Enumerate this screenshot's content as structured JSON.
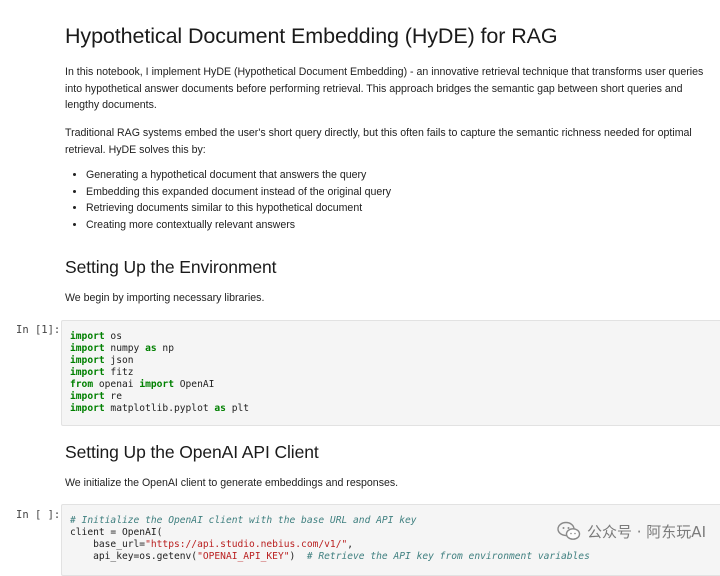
{
  "title": "Hypothetical Document Embedding (HyDE) for RAG",
  "intro_paragraph_1": "In this notebook, I implement HyDE (Hypothetical Document Embedding) - an innovative retrieval technique that transforms user queries into hypothetical answer documents before performing retrieval. This approach bridges the semantic gap between short queries and lengthy documents.",
  "intro_paragraph_2": "Traditional RAG systems embed the user's short query directly, but this often fails to capture the semantic richness needed for optimal retrieval. HyDE solves this by:",
  "hyde_steps": [
    "Generating a hypothetical document that answers the query",
    "Embedding this expanded document instead of the original query",
    "Retrieving documents similar to this hypothetical document",
    "Creating more contextually relevant answers"
  ],
  "section_1": {
    "heading": "Setting Up the Environment",
    "text": "We begin by importing necessary libraries."
  },
  "cell_1": {
    "prompt": "In [1]:",
    "code_lines": [
      [
        {
          "t": "import",
          "c": "kw"
        },
        {
          "t": " os"
        }
      ],
      [
        {
          "t": "import",
          "c": "kw"
        },
        {
          "t": " numpy "
        },
        {
          "t": "as",
          "c": "kw"
        },
        {
          "t": " np"
        }
      ],
      [
        {
          "t": "import",
          "c": "kw"
        },
        {
          "t": " json"
        }
      ],
      [
        {
          "t": "import",
          "c": "kw"
        },
        {
          "t": " fitz"
        }
      ],
      [
        {
          "t": "from",
          "c": "kw"
        },
        {
          "t": " openai "
        },
        {
          "t": "import",
          "c": "kw"
        },
        {
          "t": " OpenAI"
        }
      ],
      [
        {
          "t": "import",
          "c": "kw"
        },
        {
          "t": " re"
        }
      ],
      [
        {
          "t": "import",
          "c": "kw"
        },
        {
          "t": " matplotlib.pyplot "
        },
        {
          "t": "as",
          "c": "kw"
        },
        {
          "t": " plt"
        }
      ]
    ]
  },
  "section_2": {
    "heading": "Setting Up the OpenAI API Client",
    "text": "We initialize the OpenAI client to generate embeddings and responses."
  },
  "cell_2": {
    "prompt": "In [ ]:",
    "code_lines": [
      [
        {
          "t": "# Initialize the OpenAI client with the base URL and API key",
          "c": "cm"
        }
      ],
      [
        {
          "t": "client = OpenAI("
        }
      ],
      [
        {
          "t": "    base_url="
        },
        {
          "t": "\"https://api.studio.nebius.com/v1/\"",
          "c": "str"
        },
        {
          "t": ","
        }
      ],
      [
        {
          "t": "    api_key=os.getenv("
        },
        {
          "t": "\"OPENAI_API_KEY\"",
          "c": "str"
        },
        {
          "t": ")  "
        },
        {
          "t": "# Retrieve the API key from environment variables",
          "c": "cm"
        }
      ]
    ]
  },
  "watermark": {
    "text": "公众号 · 阿东玩AI",
    "icon": "wechat-icon"
  }
}
